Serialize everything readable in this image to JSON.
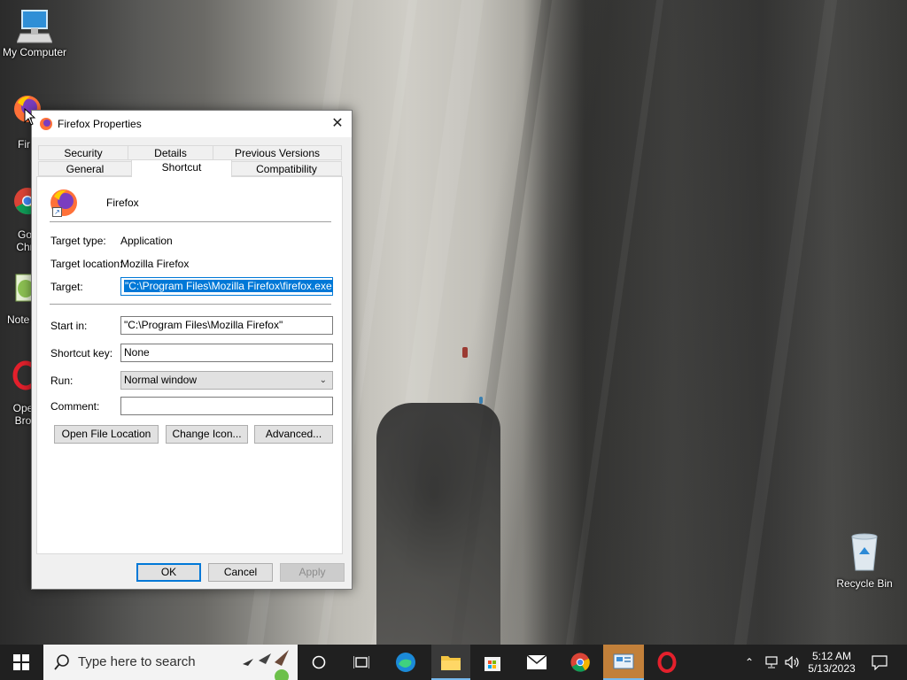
{
  "desktop": {
    "icons": [
      {
        "label": "My Computer"
      },
      {
        "label": "Fir"
      },
      {
        "label": "Go Chr"
      },
      {
        "label": "Note"
      },
      {
        "label": "Ope Bro"
      },
      {
        "label": "Recycle Bin"
      }
    ]
  },
  "dialog": {
    "title": "Firefox Properties",
    "tabs_row1": [
      "Security",
      "Details",
      "Previous Versions"
    ],
    "tabs_row2": [
      "General",
      "Shortcut",
      "Compatibility"
    ],
    "active_tab": "Shortcut",
    "app_name": "Firefox",
    "target_type_label": "Target type:",
    "target_type_value": "Application",
    "target_location_label": "Target location:",
    "target_location_value": "Mozilla Firefox",
    "target_label": "Target:",
    "target_value": "\"C:\\Program Files\\Mozilla Firefox\\firefox.exe\"",
    "start_in_label": "Start in:",
    "start_in_value": "\"C:\\Program Files\\Mozilla Firefox\"",
    "shortcut_key_label": "Shortcut key:",
    "shortcut_key_value": "None",
    "run_label": "Run:",
    "run_value": "Normal window",
    "comment_label": "Comment:",
    "comment_value": "",
    "open_file_location": "Open File Location",
    "change_icon": "Change Icon...",
    "advanced": "Advanced...",
    "ok": "OK",
    "cancel": "Cancel",
    "apply": "Apply"
  },
  "taskbar": {
    "search_placeholder": "Type here to search",
    "time": "5:12 AM",
    "date": "5/13/2023",
    "pinned": [
      "cortana-icon",
      "task-view-icon",
      "edge-icon",
      "file-explorer-icon",
      "store-icon",
      "mail-icon",
      "chrome-icon",
      "control-panel-icon",
      "opera-icon"
    ]
  },
  "colors": {
    "accent": "#0078d7",
    "taskbar": "#202020"
  }
}
